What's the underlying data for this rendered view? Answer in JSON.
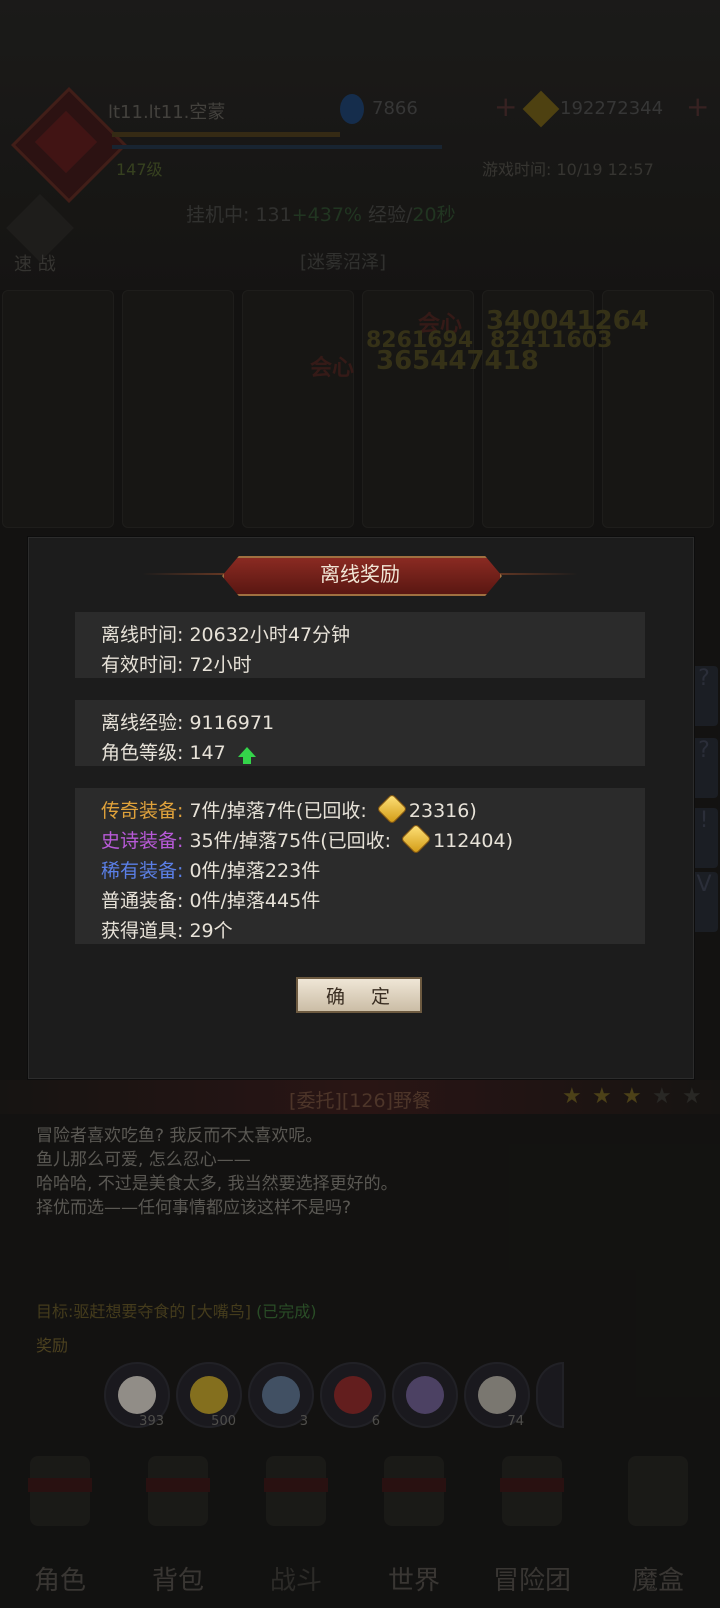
{
  "header": {
    "player_name": "lt11.lt11.空蒙",
    "level": "147级",
    "gems": "7866",
    "gold": "192272344",
    "game_time": "游戏时间: 10/19 12:57",
    "idle_prefix": "挂机中: 131",
    "idle_bonus": "+437%",
    "idle_exp": " 经验/",
    "idle_interval": "20秒",
    "zone": "[迷雾沼泽]",
    "quick_battle": "速 战"
  },
  "battle_numbers": [
    "340041264",
    "8261694",
    "82411603",
    "365447418"
  ],
  "crit_labels": [
    "会心",
    "会心"
  ],
  "side_buttons": [
    "?",
    "?",
    "!",
    "V"
  ],
  "modal": {
    "title": "离线奖励",
    "offline_time": "离线时间: 20632小时47分钟",
    "effective_time": "有效时间: 72小时",
    "offline_exp": "离线经验: 9116971",
    "role_level": "角色等级: 147",
    "legend_label": "传奇装备:",
    "legend_value_a": " 7件/掉落7件(已回收: ",
    "legend_value_b": "23316)",
    "epic_label": "史诗装备:",
    "epic_value_a": " 35件/掉落75件(已回收: ",
    "epic_value_b": "112404)",
    "rare_label": "稀有装备:",
    "rare_value": " 0件/掉落223件",
    "normal_line": "普通装备: 0件/掉落445件",
    "items_line": "获得道具: 29个",
    "confirm": "确 定"
  },
  "quest": {
    "title": "[委托][126]野餐",
    "stars_filled": 3,
    "stars_total": 5,
    "body": "冒险者喜欢吃鱼? 我反而不太喜欢呢。\n鱼儿那么可爱, 怎么忍心——\n哈哈哈, 不过是美食太多, 我当然要选择更好的。\n择优而选——任何事情都应该这样不是吗?",
    "target": "目标:驱赶想要夺食的 [大嘴鸟] ",
    "target_status": "(已完成)",
    "reward_label": "奖励",
    "rewards": [
      {
        "icon": "exp-icon",
        "count": "393",
        "color": "#c9c4bc"
      },
      {
        "icon": "gold-medal-icon",
        "count": "500",
        "color": "#b89a2a"
      },
      {
        "icon": "star-badge-icon",
        "count": "3",
        "color": "#5a6f8a"
      },
      {
        "icon": "red-medal-icon",
        "count": "6",
        "color": "#8a2a2a"
      },
      {
        "icon": "boots-icon",
        "count": "",
        "color": "#6a5a8a"
      },
      {
        "icon": "glove-icon",
        "count": "74",
        "color": "#aaa59c"
      },
      {
        "icon": "box-icon",
        "count": "",
        "color": "#5a6a4a"
      }
    ]
  },
  "nav": [
    "角色",
    "背包",
    "战斗",
    "世界",
    "冒险团",
    "魔盒"
  ],
  "colors": {
    "legend": "#e0a23a",
    "epic": "#b85ad8",
    "rare": "#5a7fe6",
    "confirm_bg": "#e6dccb",
    "title_banner": "#7a2019"
  }
}
